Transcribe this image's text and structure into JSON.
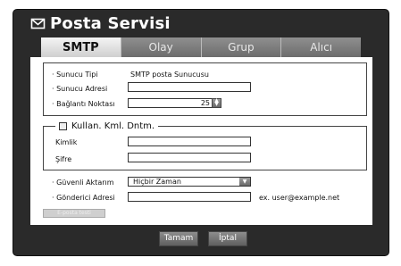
{
  "window": {
    "title": "Posta Servisi",
    "icon": "mail-icon"
  },
  "tabs": [
    {
      "label": "SMTP",
      "active": true
    },
    {
      "label": "Olay",
      "active": false
    },
    {
      "label": "Grup",
      "active": false
    },
    {
      "label": "Alıcı",
      "active": false
    }
  ],
  "server": {
    "type_label": "· Sunucu Tipi",
    "type_value": "SMTP posta Sunucusu",
    "address_label": "· Sunucu Adresi",
    "address_value": "",
    "port_label": "· Bağlantı Noktası",
    "port_value": "25"
  },
  "auth": {
    "checkbox_label": "Kullan. Kml. Dntm.",
    "checked": false,
    "id_label": "Kimlik",
    "id_value": "",
    "password_label": "Şifre",
    "password_value": ""
  },
  "security": {
    "label": "· Güvenli Aktarım",
    "selected": "Hiçbir Zaman"
  },
  "sender": {
    "label": "· Gönderici Adresi",
    "value": "",
    "hint": "ex. user@example.net"
  },
  "test_button": "E-posta testi",
  "buttons": {
    "ok": "Tamam",
    "cancel": "İptal"
  },
  "colors": {
    "frame": "#2a2a2a",
    "active_tab": "#e4e4e4",
    "inactive_tab": "#7c7c7c"
  }
}
